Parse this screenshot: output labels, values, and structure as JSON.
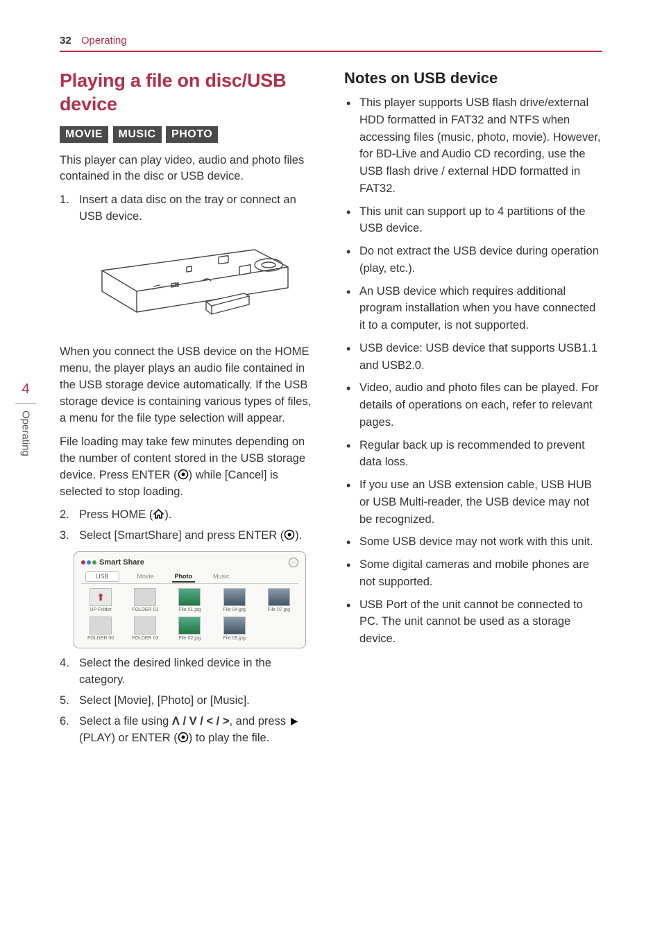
{
  "header": {
    "page_number": "32",
    "section": "Operating"
  },
  "sidetab": {
    "chapter_number": "4",
    "chapter_name": "Operating"
  },
  "left": {
    "title": "Playing a file on disc/USB device",
    "tags": [
      "MOVIE",
      "MUSIC",
      "PHOTO"
    ],
    "intro": "This player can play video, audio and photo files contained in the disc or USB device.",
    "step1": "Insert a data disc on the tray or connect an USB device.",
    "para2": "When you connect the USB device on the HOME menu, the player plays an audio file contained in the USB storage device automatically. If the USB storage device is containing various types of files, a menu for the file type selection will appear.",
    "para3_a": "File loading may take few minutes depending on the number of content stored in the USB storage device. Press ENTER (",
    "para3_b": ") while [Cancel] is selected to stop loading.",
    "step2_a": "Press HOME (",
    "step2_b": ").",
    "step3_a": "Select [SmartShare] and press ENTER (",
    "step3_b": ").",
    "step4": "Select the desired linked device in the category.",
    "step5": "Select [Movie], [Photo] or [Music].",
    "step6_a": "Select a file using ",
    "step6_b": ", and press ",
    "step6_c": "(PLAY) or ENTER (",
    "step6_d": ") to play the file.",
    "arrows": "Ʌ / V / < / >"
  },
  "ss": {
    "title": "Smart Share",
    "device": "USB",
    "tabs": {
      "movie": "Movie",
      "photo": "Photo",
      "music": "Music"
    },
    "items": [
      "UP Folder",
      "FOLDER 01",
      "File 01.jpg",
      "File 04.jpg",
      "File 07.jpg",
      "FOLDER 00",
      "FOLDER 03",
      "File 02.jpg",
      "File 05.jpg"
    ]
  },
  "right": {
    "title": "Notes on USB device",
    "notes": [
      "This player supports USB flash drive/external HDD formatted in FAT32 and NTFS when accessing files (music, photo, movie). However, for BD-Live and Audio CD recording, use the USB flash drive / external HDD formatted in FAT32.",
      "This unit can support up to 4 partitions of the USB device.",
      "Do not extract the USB device during operation (play, etc.).",
      "An USB device which requires additional program installation when you have connected it to a computer, is not supported.",
      "USB device: USB device that supports USB1.1 and USB2.0.",
      "Video, audio and photo files can be played. For details of operations on each, refer to relevant pages.",
      "Regular back up is recommended to prevent data loss.",
      "If you use an USB extension cable, USB HUB or USB Multi-reader, the USB device may not be recognized.",
      "Some USB device may not work with this unit.",
      "Some digital cameras and mobile phones are not supported.",
      "USB Port of the unit cannot be connected to PC. The unit cannot be used as a storage device."
    ]
  }
}
